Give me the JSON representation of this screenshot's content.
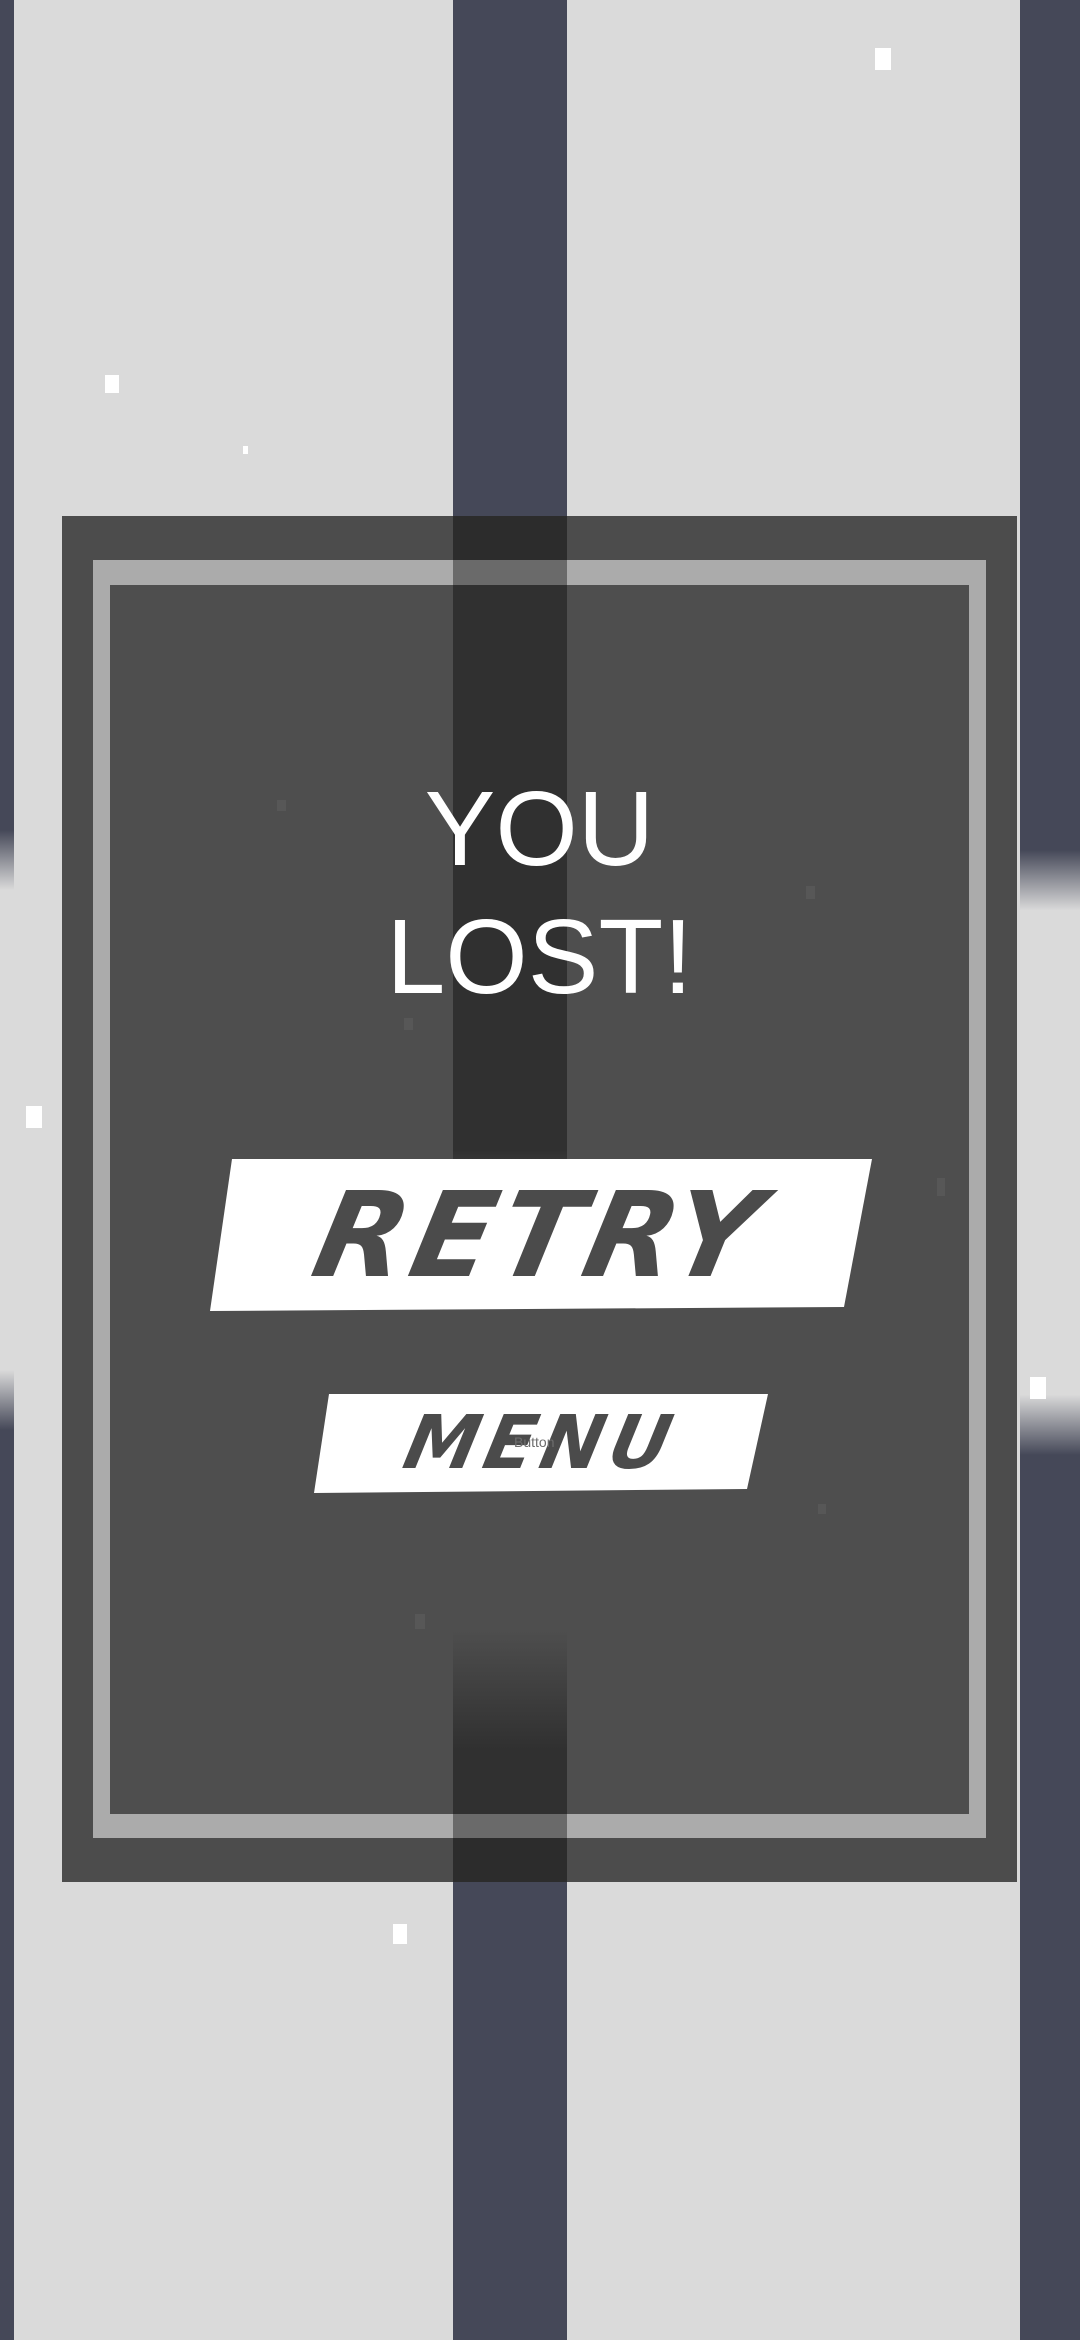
{
  "game_over": {
    "title_line1": "YOU",
    "title_line2": "LOST!"
  },
  "buttons": {
    "retry_label": "RETRY",
    "menu_label": "MENU",
    "menu_small_caption": "Button"
  },
  "colors": {
    "background": "#dadada",
    "stripe": "#454858",
    "dialog": "#474747",
    "frame": "#ababab",
    "button_fill": "#ffffff",
    "button_text": "#4b4b4b"
  }
}
